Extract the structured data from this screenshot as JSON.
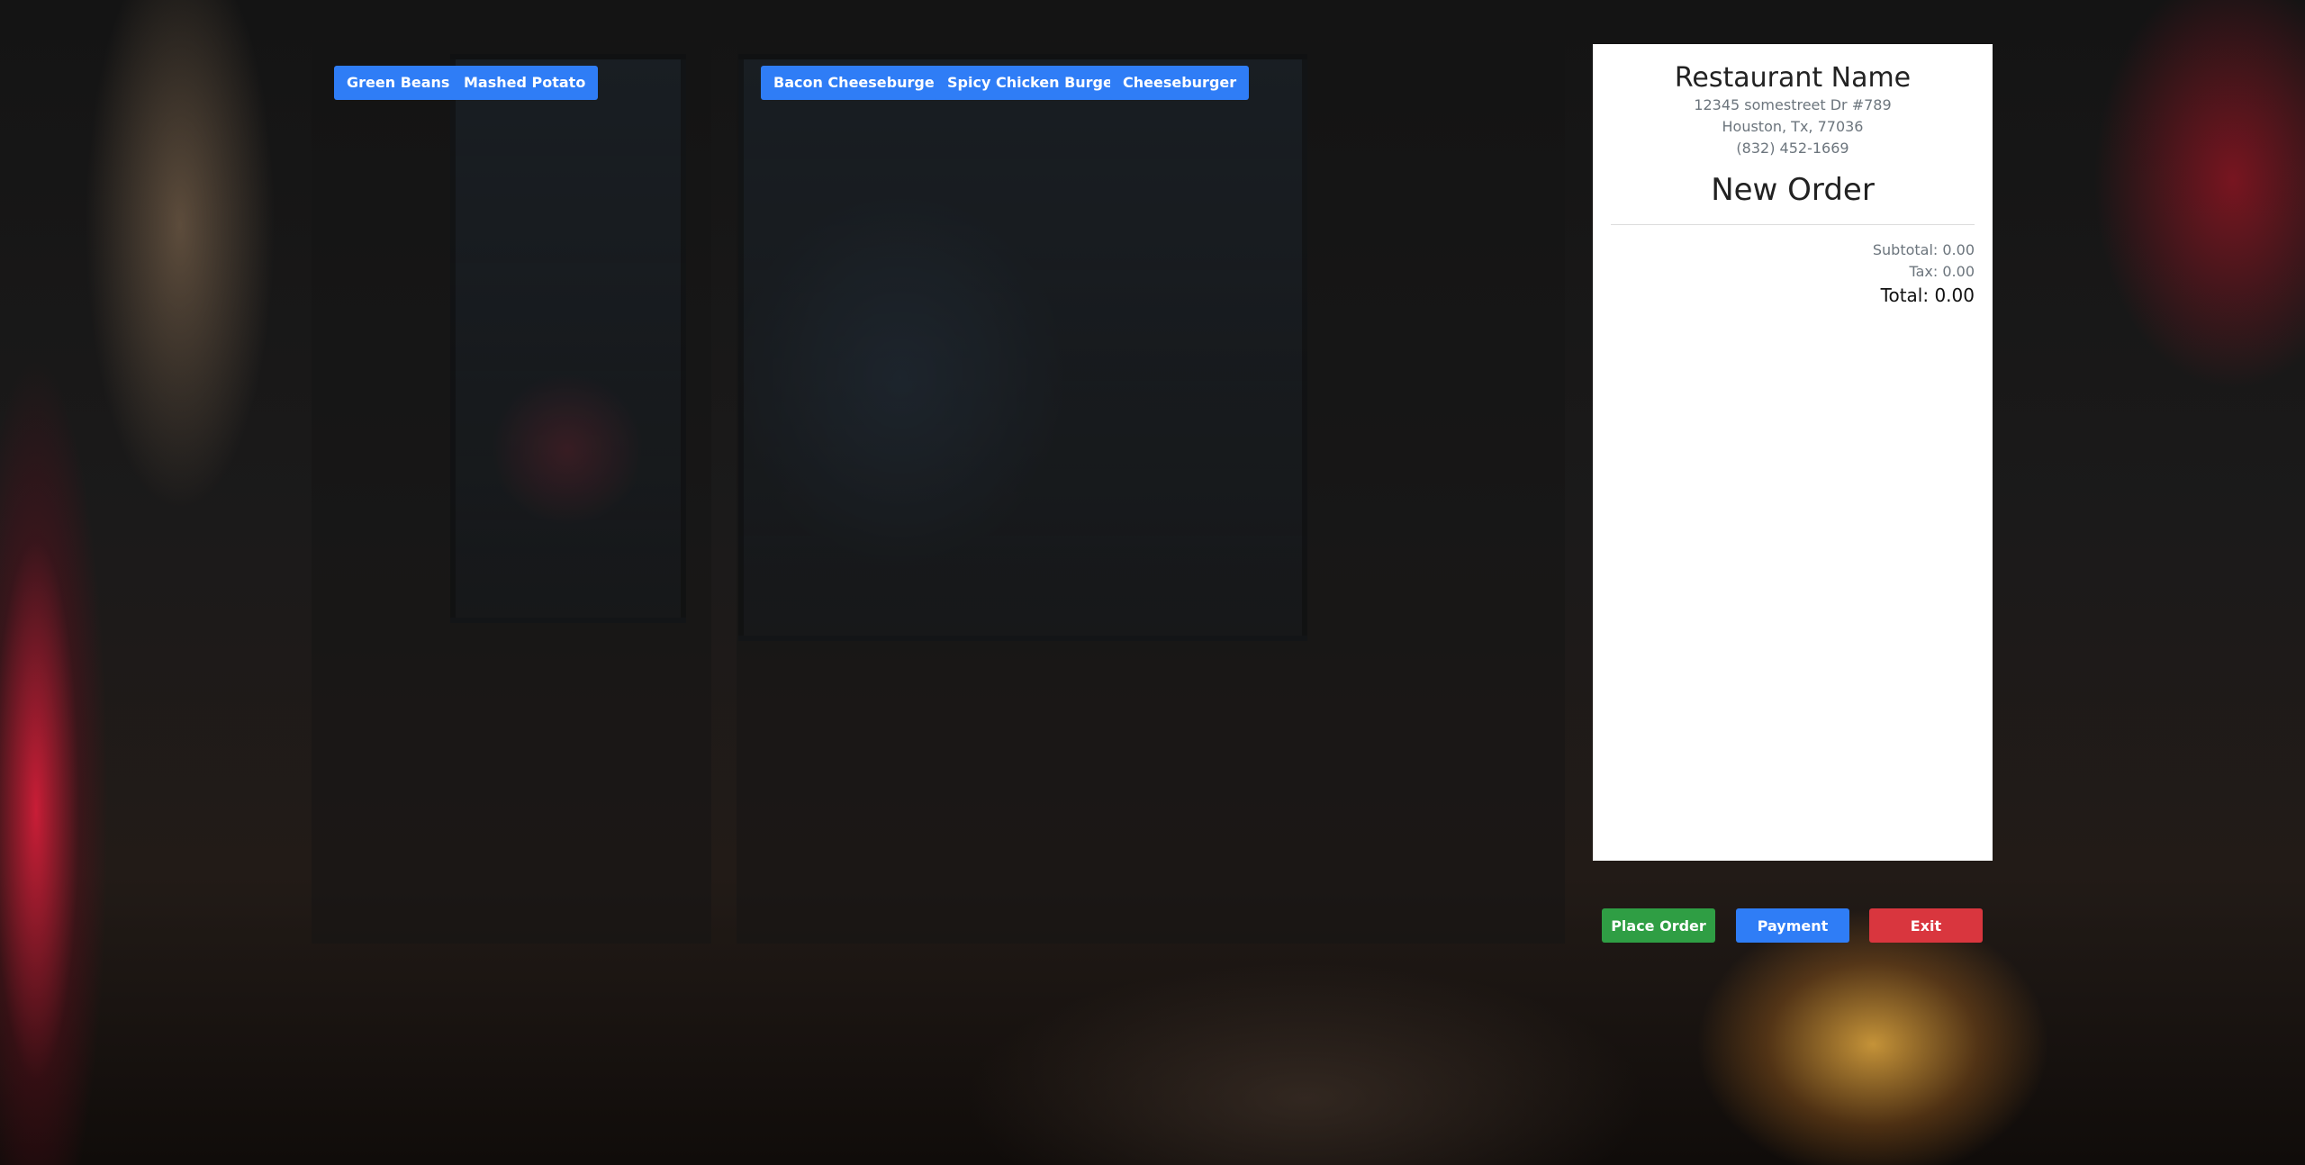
{
  "categories": {
    "sides": [
      "Green Beans",
      "Mashed Potato"
    ],
    "burgers": [
      "Bacon Cheeseburger",
      "Spicy Chicken Burger",
      "Cheeseburger"
    ]
  },
  "receipt": {
    "restaurant_name": "Restaurant Name",
    "address_line1": "12345 somestreet Dr #789",
    "address_line2": "Houston, Tx, 77036",
    "phone": "(832) 452-1669",
    "title": "New Order",
    "subtotal": "Subtotal: 0.00",
    "tax": "Tax: 0.00",
    "total": "Total: 0.00"
  },
  "actions": {
    "place_order": "Place Order",
    "payment": "Payment",
    "exit": "Exit"
  },
  "colors": {
    "primary": "#2f7df6",
    "success": "#2f9e44",
    "danger": "#d9363e"
  }
}
